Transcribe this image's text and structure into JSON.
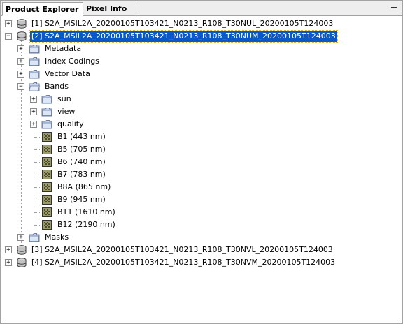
{
  "tabs": [
    {
      "label": "Product Explorer",
      "active": true
    },
    {
      "label": "Pixel Info",
      "active": false
    }
  ],
  "panel": {
    "minimize_icon": "minimize-icon",
    "minimize_glyph": "▁"
  },
  "products": [
    {
      "label": "[1] S2A_MSIL2A_20200105T103421_N0213_R108_T30NUL_20200105T124003",
      "expanded": false
    },
    {
      "label": "[2] S2A_MSIL2A_20200105T103421_N0213_R108_T30NUM_20200105T124003",
      "expanded": true,
      "selected": true
    },
    {
      "label": "[3] S2A_MSIL2A_20200105T103421_N0213_R108_T30NVL_20200105T124003",
      "expanded": false
    },
    {
      "label": "[4] S2A_MSIL2A_20200105T103421_N0213_R108_T30NVM_20200105T124003",
      "expanded": false
    }
  ],
  "product2_children": {
    "metadata": "Metadata",
    "index_codings": "Index Codings",
    "vector_data": "Vector Data",
    "bands": "Bands",
    "masks": "Masks"
  },
  "band_groups": [
    "sun",
    "view",
    "quality"
  ],
  "bands": [
    "B1 (443 nm)",
    "B5 (705 nm)",
    "B6 (740 nm)",
    "B7 (783 nm)",
    "B8A (865 nm)",
    "B9 (945 nm)",
    "B11 (1610 nm)",
    "B12 (2190 nm)"
  ],
  "colors": {
    "selection": "#0a58c8",
    "folder": "#c8d4ea",
    "folder_border": "#6a7ea8"
  }
}
